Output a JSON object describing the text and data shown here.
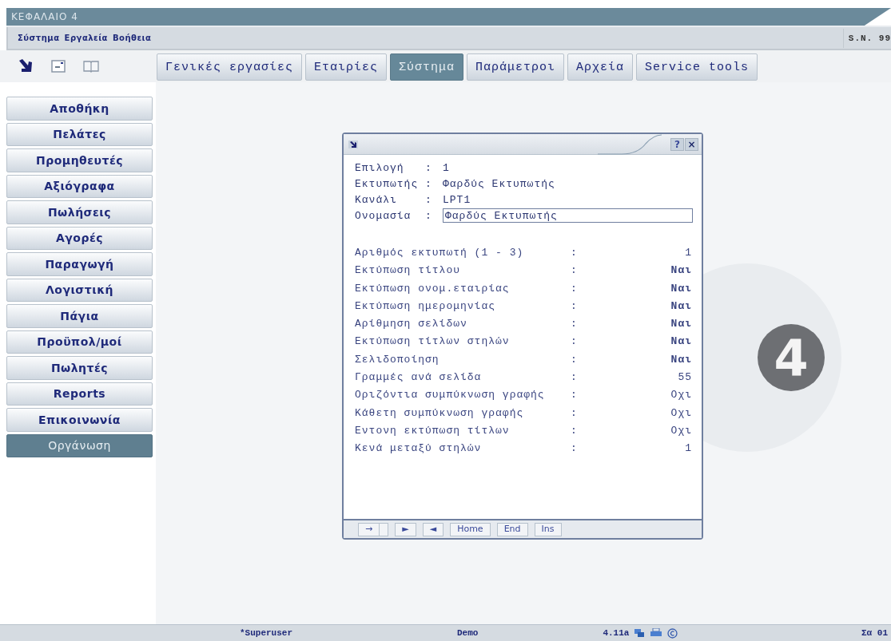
{
  "window": {
    "title": "ΚΕΦΑΛΑΙΟ 4"
  },
  "menu": {
    "items": [
      "Σύστημα",
      "Εργαλεία",
      "Βοήθεια"
    ],
    "serial": "S.N. 99"
  },
  "tabs": [
    {
      "label": "Γενικές εργασίες",
      "selected": false
    },
    {
      "label": "Εταιρίες",
      "selected": false
    },
    {
      "label": "Σύστημα",
      "selected": true
    },
    {
      "label": "Παράμετροι",
      "selected": false
    },
    {
      "label": "Αρχεία",
      "selected": false
    },
    {
      "label": "Service tools",
      "selected": false
    }
  ],
  "sidebar": {
    "items": [
      {
        "label": "Αποθήκη",
        "selected": false
      },
      {
        "label": "Πελάτες",
        "selected": false
      },
      {
        "label": "Προμηθευτές",
        "selected": false
      },
      {
        "label": "Αξιόγραφα",
        "selected": false
      },
      {
        "label": "Πωλήσεις",
        "selected": false
      },
      {
        "label": "Αγορές",
        "selected": false
      },
      {
        "label": "Παραγωγή",
        "selected": false
      },
      {
        "label": "Λογιστική",
        "selected": false
      },
      {
        "label": "Πάγια",
        "selected": false
      },
      {
        "label": "Προϋπολ/μοί",
        "selected": false
      },
      {
        "label": "Πωλητές",
        "selected": false
      },
      {
        "label": "Reports",
        "selected": false
      },
      {
        "label": "Επικοινωνία",
        "selected": false
      },
      {
        "label": "Οργάνωση",
        "selected": true
      }
    ]
  },
  "logo_text": "4",
  "dialog": {
    "help": "?",
    "close": "×",
    "header_fields": [
      {
        "label": "Επιλογή",
        "sep": ":",
        "value": "1"
      },
      {
        "label": "Εκτυπωτής",
        "sep": ":",
        "value": "Φαρδύς Εκτυπωτής"
      },
      {
        "label": "Κανάλι",
        "sep": ":",
        "value": "LPT1"
      }
    ],
    "name_field": {
      "label": "Ονομασία",
      "sep": ":",
      "value": "Φαρδύς Εκτυπωτής"
    },
    "settings": [
      {
        "label": "Αριθμός εκτυπωτή (1 - 3)",
        "sep": ":",
        "value": "1",
        "bold": false
      },
      {
        "label": "Εκτύπωση τίτλου",
        "sep": ":",
        "value": "Ναι",
        "bold": true
      },
      {
        "label": "Εκτύπωση ονομ.εταιρίας",
        "sep": ":",
        "value": "Ναι",
        "bold": true
      },
      {
        "label": "Εκτύπωση ημερομηνίας",
        "sep": ":",
        "value": "Ναι",
        "bold": true
      },
      {
        "label": "Αρίθμηση σελίδων",
        "sep": ":",
        "value": "Ναι",
        "bold": true
      },
      {
        "label": "Εκτύπωση τίτλων στηλών",
        "sep": ":",
        "value": "Ναι",
        "bold": true
      },
      {
        "label": "Σελιδοποίηση",
        "sep": ":",
        "value": "Ναι",
        "bold": true
      },
      {
        "label": "Γραμμές ανά σελίδα",
        "sep": ":",
        "value": "55",
        "bold": false
      },
      {
        "label": "Οριζόντια συμπύκνωση γραφής",
        "sep": ":",
        "value": "Οχι",
        "bold": false
      },
      {
        "label": "Κάθετη συμπύκνωση γραφής",
        "sep": ":",
        "value": "Οχι",
        "bold": false
      },
      {
        "label": "Εντονη εκτύπωση τίτλων",
        "sep": ":",
        "value": "Οχι",
        "bold": false
      },
      {
        "label": "Κενά μεταξύ στηλών",
        "sep": ":",
        "value": "1",
        "bold": false
      }
    ],
    "keys": [
      {
        "kind": "text",
        "label": "→"
      },
      {
        "kind": "blank"
      },
      {
        "kind": "text",
        "label": "►"
      },
      {
        "kind": "text",
        "label": "◄"
      },
      {
        "kind": "text",
        "label": "Home"
      },
      {
        "kind": "text",
        "label": "End"
      },
      {
        "kind": "text",
        "label": "Ins"
      }
    ]
  },
  "status_bar": {
    "user": "*Superuser",
    "mode": "Demo",
    "version": "4.11a",
    "date": "Σα 01"
  }
}
